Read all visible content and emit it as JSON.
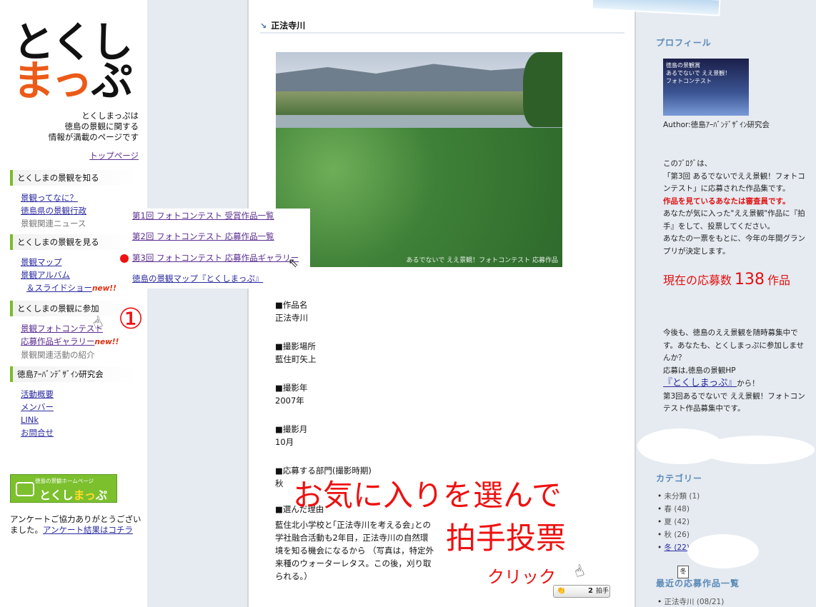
{
  "left": {
    "logo_line1": "とくし",
    "logo_line2_orange": "まっ",
    "logo_line2_black": "ぷ",
    "tagline": [
      "とくしまっぷは",
      "徳島の景観に関する",
      "情報が満載のページです"
    ],
    "top_link": "トップページ",
    "sections": [
      {
        "heading": "とくしまの景観を知る",
        "links": [
          "景観ってなに？",
          "徳島県の景観行政",
          "景観関連ニュース"
        ]
      },
      {
        "heading": "とくしまの景観を見る",
        "links": [
          "景観マップ",
          "景観アルバム",
          "＆スライドショー"
        ]
      },
      {
        "heading": "とくしまの景観に参加",
        "links": [
          "景観フォトコンテスト",
          "応募作品ギャラリー",
          "景観関連活動の紹介"
        ]
      },
      {
        "heading": "徳島ｱｰﾊﾞﾝﾃﾞｻﾞｲﾝ研究会",
        "links": [
          "活動概要",
          "メンバー",
          "LINk",
          "お問合せ"
        ]
      }
    ],
    "new_badge": "new!!",
    "banner_small": "徳島の景観ホームページ",
    "banner_big_1": "とくし",
    "banner_big_2": "まっ",
    "banner_big_3": "ぷ",
    "survey_text": "アンケートご協力ありがとうございました。",
    "survey_link": "アンケート結果はコチラ"
  },
  "popup": {
    "items": [
      "第1回 フォトコンテスト 受賞作品一覧",
      "第2回 フォトコンテスト 応募作品一覧",
      "第3回 フォトコンテスト 応募作品ギャラリー",
      "徳島の景観マップ『とくしまっぷ』"
    ]
  },
  "annotation": {
    "circled_number": "①",
    "favorite_line1": "お気に入りを選んで",
    "favorite_line2": "拍手投票",
    "click": "クリック"
  },
  "main": {
    "title": "正法寺川",
    "photo_watermark": "あるでないで ええ景観！フォトコンテスト 応募作品",
    "fields": [
      {
        "label": "■作品名",
        "value": "正法寺川"
      },
      {
        "label": "■撮影場所",
        "value": "藍住町矢上"
      },
      {
        "label": "■撮影年",
        "value": "2007年"
      },
      {
        "label": "■撮影月",
        "value": "10月"
      },
      {
        "label": "■応募する部門(撮影時期)",
        "value": "秋"
      }
    ],
    "reason_label": "■選んだ理由",
    "reason_text": "藍住北小学校と｢正法寺川を考える会｣との学社融合活動も2年目，正法寺川の自然環境を知る機会になるから （写真は，特定外来種のウォーターレタス。この後，刈り取られる。）",
    "clap_count": "2",
    "clap_label": "拍手"
  },
  "right": {
    "profile_heading": "プロフィール",
    "profile_image_text": [
      "徳島の景観賞",
      "あるでないで ええ景観！",
      "フォトコンテスト"
    ],
    "author": "Author:徳島ｱｰﾊﾞﾝﾃﾞｻﾞｲﾝ研究会",
    "blog_intro_1": "このﾌﾞﾛｸﾞは、",
    "blog_intro_2": "「第3回 あるでないでええ景観！フォトコンテスト」に応募された作品集です。",
    "blog_red": "作品を見ているあなたは審査員です。",
    "blog_intro_3": "あなたが気に入った\"ええ景観\"作品に『拍手』をして、投票してください。",
    "blog_intro_4": "あなたの一票をもとに、今年の年間グランプリが決定します。",
    "count_prefix": "現在の応募数",
    "count_number": "138",
    "count_suffix": "作品",
    "recruit_1": "今後も、徳島のええ景観を随時募集中です。あなたも、とくしまっぷに参加しませんか？",
    "recruit_2": "応募は,徳島の景観HP",
    "recruit_link": "『とくしまっぷ』",
    "recruit_3": "から！",
    "recruit_4": "第3回あるでないで ええ景観！フォトコンテスト作品募集中です。",
    "category_heading": "カテゴリー",
    "categories": [
      {
        "name": "未分類",
        "count": "(1)"
      },
      {
        "name": "春",
        "count": "(48)"
      },
      {
        "name": "夏",
        "count": "(42)"
      },
      {
        "name": "秋",
        "count": "(26)"
      },
      {
        "name": "冬",
        "count": "(22)"
      }
    ],
    "recent_heading": "最近の応募作品一覧",
    "recent": [
      {
        "name": "正法寺川",
        "date": "(08/21)"
      }
    ],
    "winter_tooltip": "冬"
  }
}
